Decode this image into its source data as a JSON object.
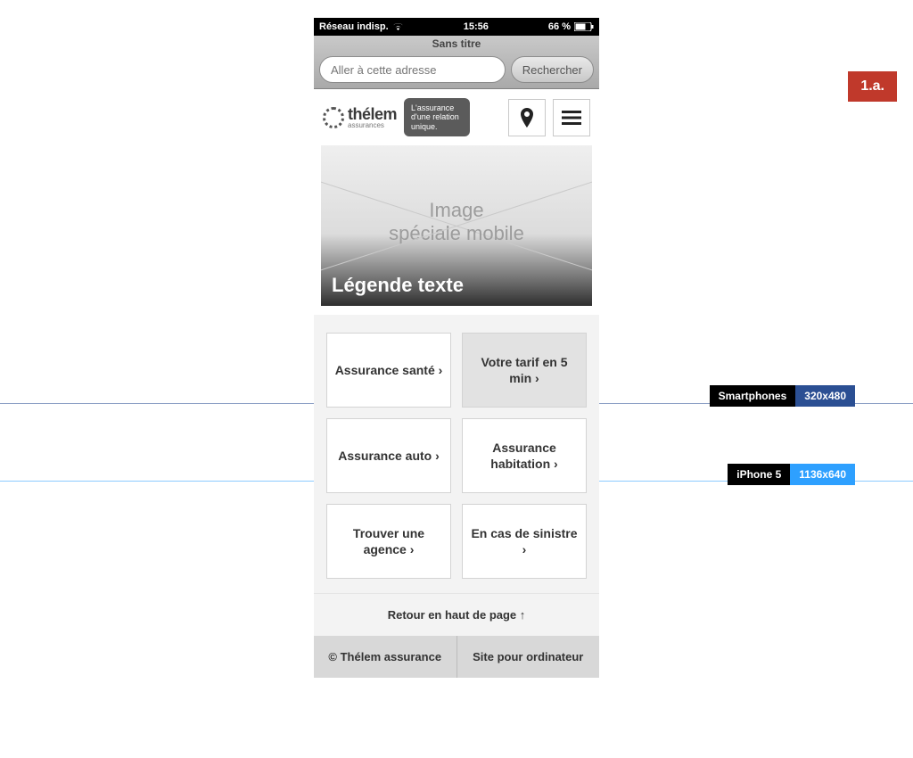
{
  "badge": "1.a.",
  "guides": {
    "smartphones_label": "Smartphones",
    "smartphones_res": "320x480",
    "iphone5_label": "iPhone 5",
    "iphone5_res": "1136x640"
  },
  "statusbar": {
    "carrier": "Réseau indisp.",
    "time": "15:56",
    "battery": "66 %"
  },
  "safari": {
    "window_title": "Sans titre",
    "address_placeholder": "Aller à cette adresse",
    "search_label": "Rechercher"
  },
  "header": {
    "logo_line1": "thélem",
    "logo_line2": "assurances",
    "tagline": "L'assurance d'une relation unique."
  },
  "hero": {
    "placeholder_line1": "Image",
    "placeholder_line2": "spéciale mobile",
    "caption": "Légende texte"
  },
  "tiles": [
    {
      "label": "Assurance santé ›"
    },
    {
      "label": "Votre tarif en 5 min ›"
    },
    {
      "label": "Assurance auto ›"
    },
    {
      "label": "Assurance habitation ›"
    },
    {
      "label": "Trouver une agence ›"
    },
    {
      "label": "En cas de sinistre ›"
    }
  ],
  "backtop": "Retour en haut de page  ↑",
  "footer": {
    "copyright": "© Thélem assurance",
    "desktop_link": "Site pour ordinateur"
  }
}
